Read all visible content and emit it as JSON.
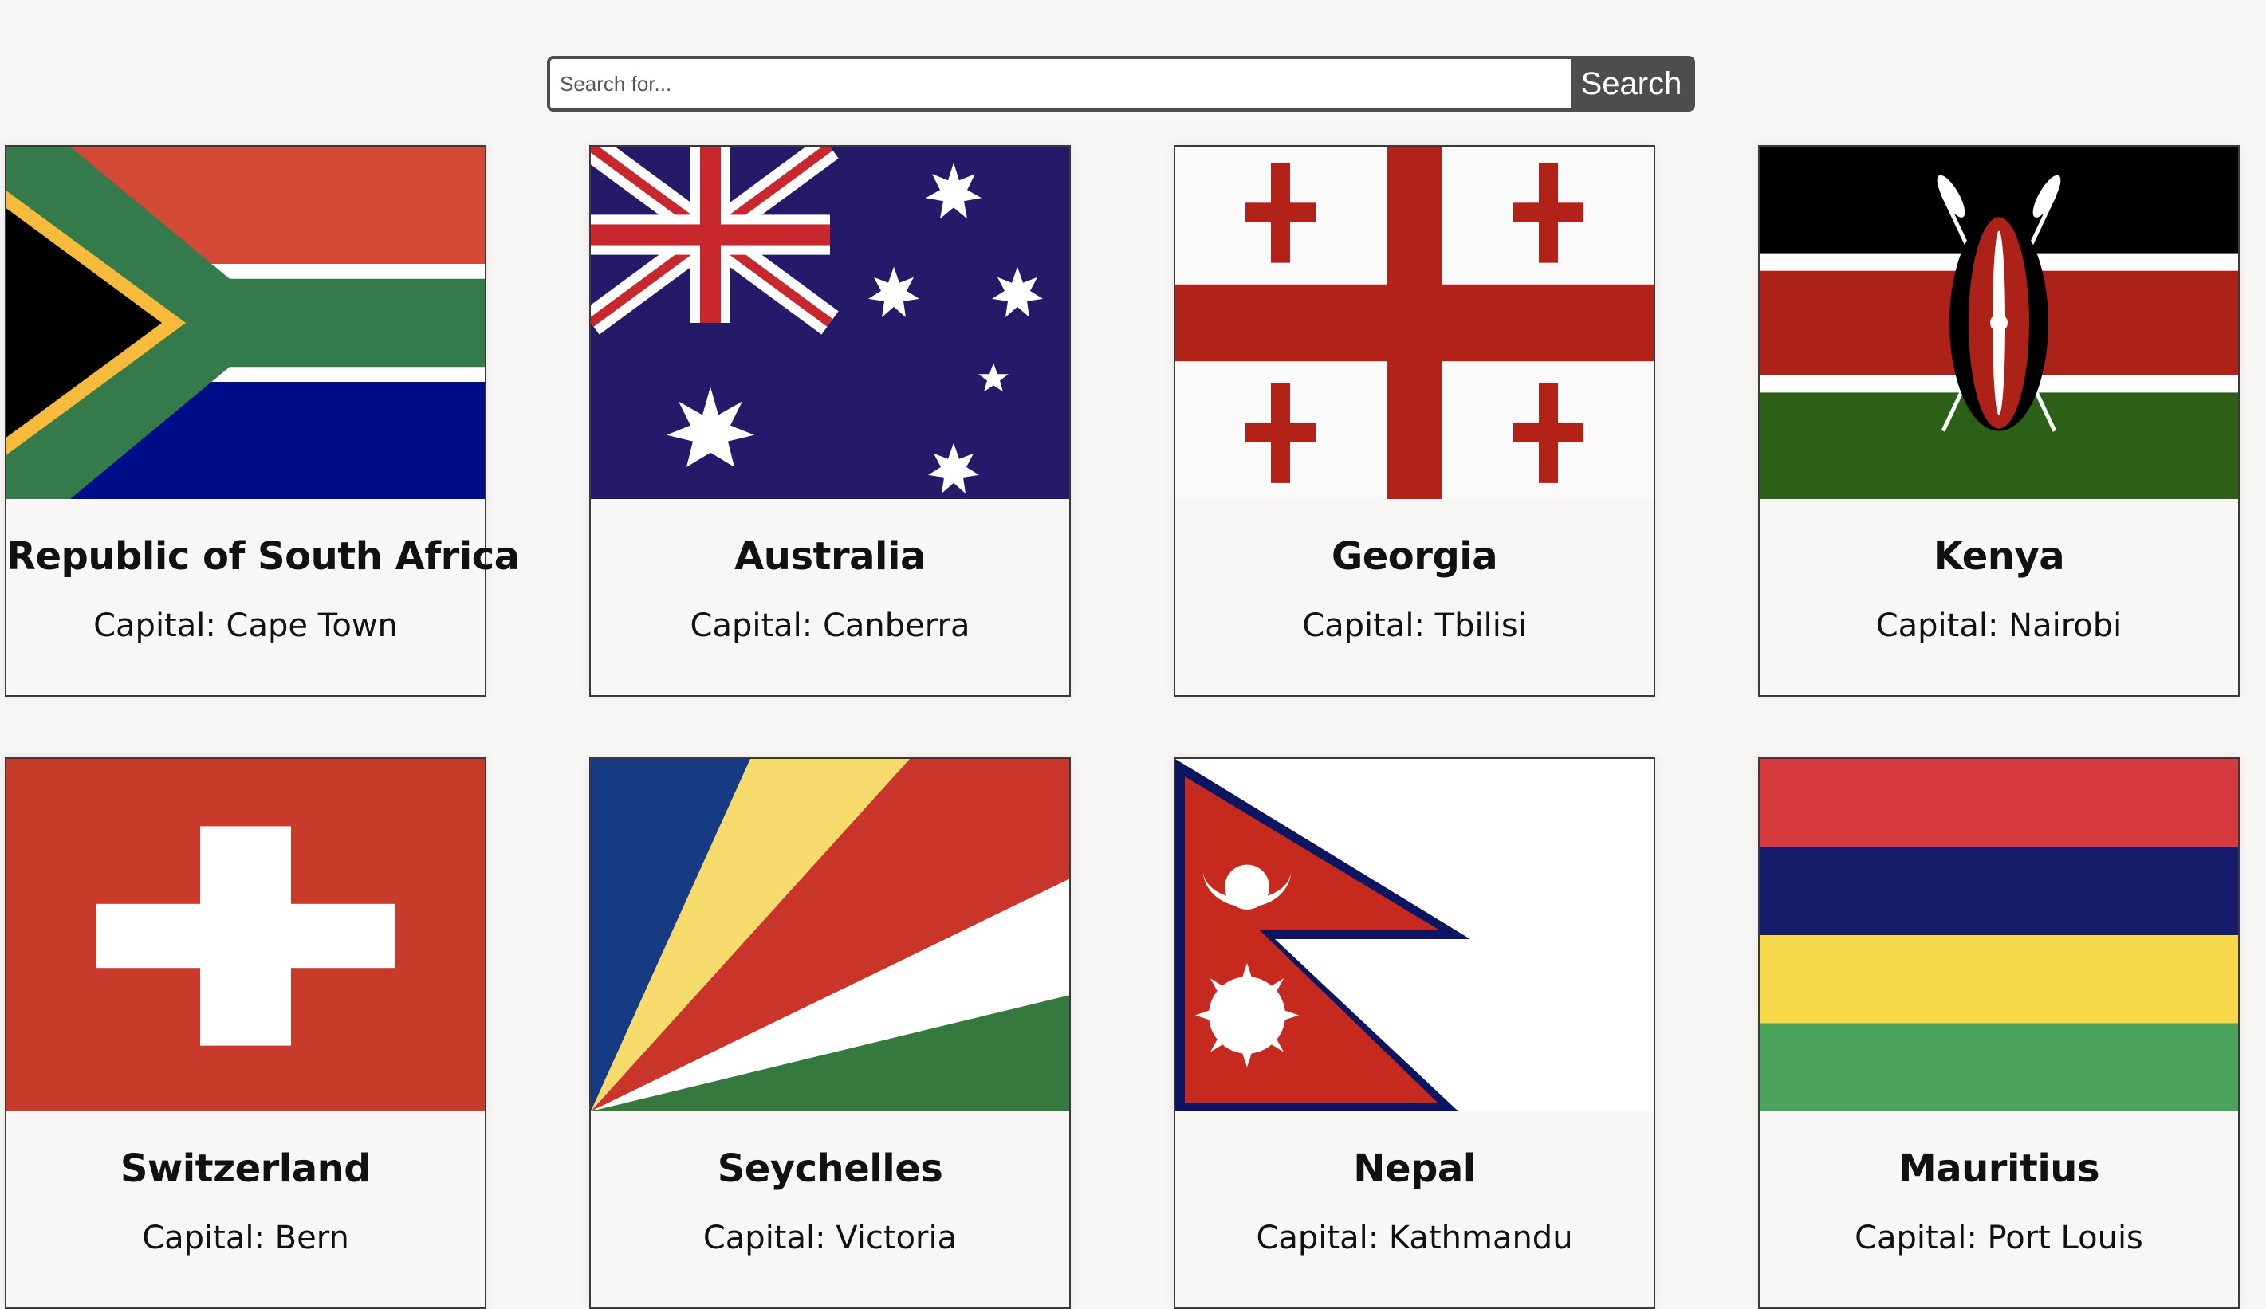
{
  "search": {
    "placeholder": "Search for...",
    "button_label": "Search"
  },
  "countries": [
    {
      "name": "Republic of South Africa",
      "capital": "Capital: Cape Town",
      "flag_icon": "south-africa-flag"
    },
    {
      "name": "Australia",
      "capital": "Capital: Canberra",
      "flag_icon": "australia-flag"
    },
    {
      "name": "Georgia",
      "capital": "Capital: Tbilisi",
      "flag_icon": "georgia-flag"
    },
    {
      "name": "Kenya",
      "capital": "Capital: Nairobi",
      "flag_icon": "kenya-flag"
    },
    {
      "name": "Switzerland",
      "capital": "Capital: Bern",
      "flag_icon": "switzerland-flag"
    },
    {
      "name": "Seychelles",
      "capital": "Capital: Victoria",
      "flag_icon": "seychelles-flag"
    },
    {
      "name": "Nepal",
      "capital": "Capital: Kathmandu",
      "flag_icon": "nepal-flag"
    },
    {
      "name": "Mauritius",
      "capital": "Capital: Port Louis",
      "flag_icon": "mauritius-flag"
    }
  ],
  "colors": {
    "background": "#f8f7f5",
    "search_border": "#4d4d4d",
    "card_border": "#3a3a3a"
  }
}
